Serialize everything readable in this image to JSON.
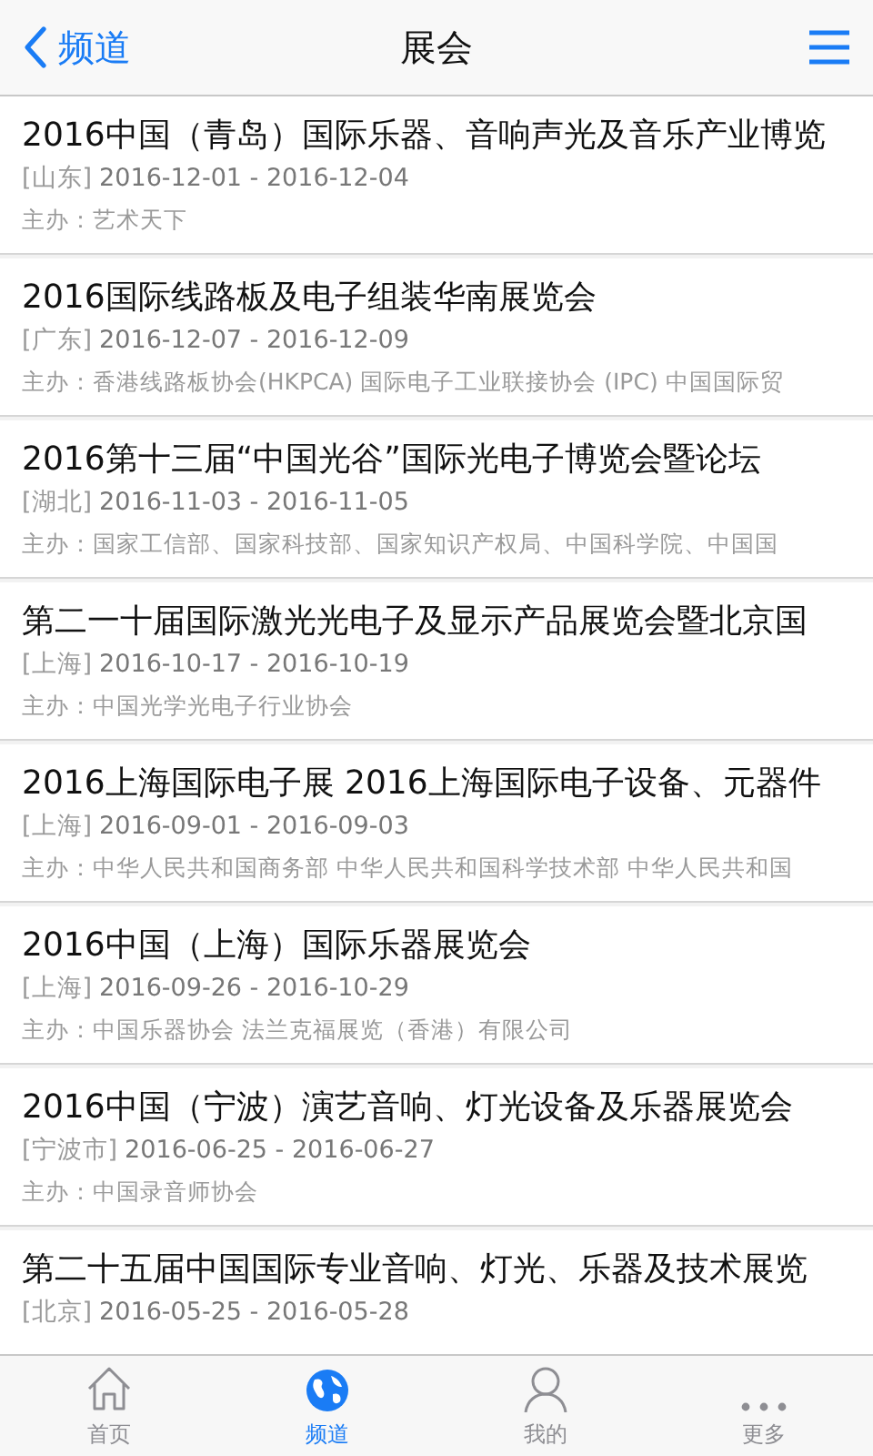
{
  "nav": {
    "back_label": "频道",
    "title": "展会"
  },
  "exhibitions": [
    {
      "title": "2016中国（青岛）国际乐器、音响声光及音乐产业博览",
      "region": "[山东]",
      "dates": "2016-12-01 - 2016-12-04",
      "organizer": "主办：艺术天下"
    },
    {
      "title": "2016国际线路板及电子组装华南展览会",
      "region": "[广东]",
      "dates": "2016-12-07 - 2016-12-09",
      "organizer": "主办：香港线路板协会(HKPCA) 国际电子工业联接协会 (IPC) 中国国际贸"
    },
    {
      "title": "2016第十三届“中国光谷”国际光电子博览会暨论坛",
      "region": "[湖北]",
      "dates": "2016-11-03 - 2016-11-05",
      "organizer": "主办：国家工信部、国家科技部、国家知识产权局、中国科学院、中国国"
    },
    {
      "title": "第二一十届国际激光光电子及显示产品展览会暨北京国",
      "region": "[上海]",
      "dates": "2016-10-17 - 2016-10-19",
      "organizer": "主办：中国光学光电子行业协会"
    },
    {
      "title": "2016上海国际电子展 2016上海国际电子设备、元器件",
      "region": "[上海]",
      "dates": "2016-09-01 - 2016-09-03",
      "organizer": "主办：中华人民共和国商务部 中华人民共和国科学技术部 中华人民共和国"
    },
    {
      "title": "2016中国（上海）国际乐器展览会",
      "region": "[上海]",
      "dates": "2016-09-26 - 2016-10-29",
      "organizer": "主办：中国乐器协会 法兰克福展览（香港）有限公司"
    },
    {
      "title": "2016中国（宁波）演艺音响、灯光设备及乐器展览会",
      "region": "[宁波市]",
      "dates": "2016-06-25 - 2016-06-27",
      "organizer": "主办：中国录音师协会"
    },
    {
      "title": "第二十五届中国国际专业音响、灯光、乐器及技术展览",
      "region": "[北京]",
      "dates": "2016-05-25 - 2016-05-28"
    }
  ],
  "tabs": [
    {
      "kind": "home",
      "label": "首页",
      "selected": false
    },
    {
      "kind": "globe",
      "label": "频道",
      "selected": true
    },
    {
      "kind": "person",
      "label": "我的",
      "selected": false
    },
    {
      "kind": "more",
      "label": "更多",
      "selected": false
    }
  ]
}
